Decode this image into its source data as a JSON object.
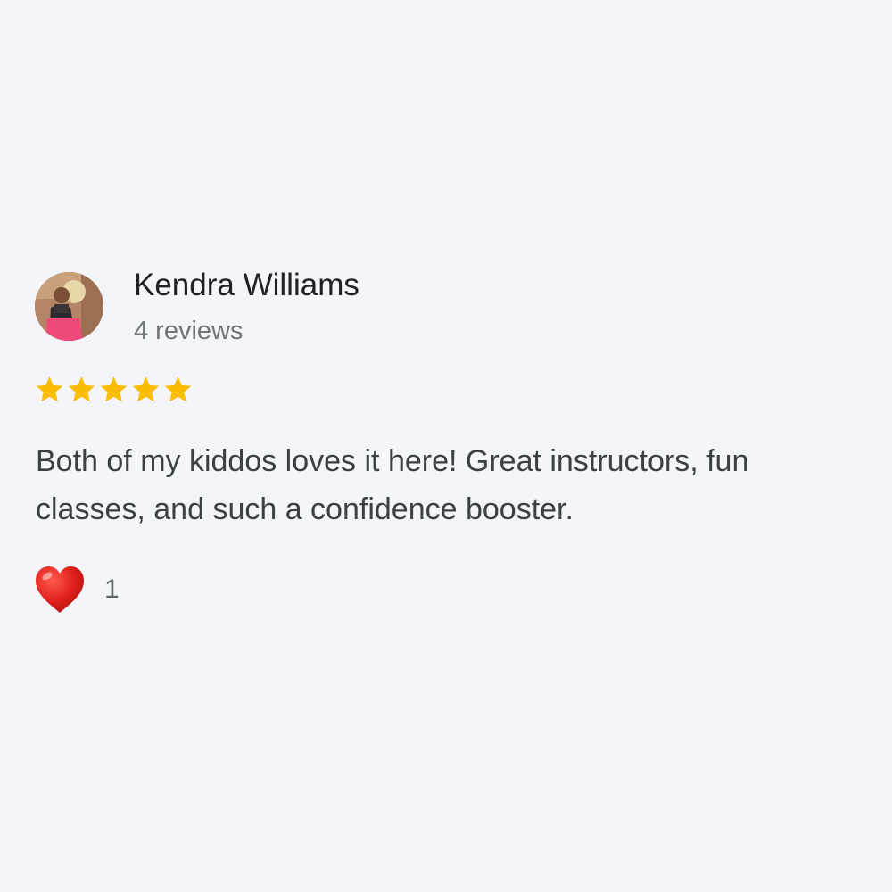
{
  "review": {
    "reviewer_name": "Kendra Williams",
    "review_count": "4 reviews",
    "rating": 5,
    "rating_max": 5,
    "text": "Both of my kiddos loves it here! Great instructors, fun classes, and such a confidence booster.",
    "reaction": {
      "icon": "heart-icon",
      "count": "1"
    }
  },
  "colors": {
    "background": "#f3f5f8",
    "star": "#fbbc04",
    "heart": "#e0201d",
    "name_text": "#202124",
    "body_text": "#3c4043",
    "secondary_text": "#70757a"
  }
}
